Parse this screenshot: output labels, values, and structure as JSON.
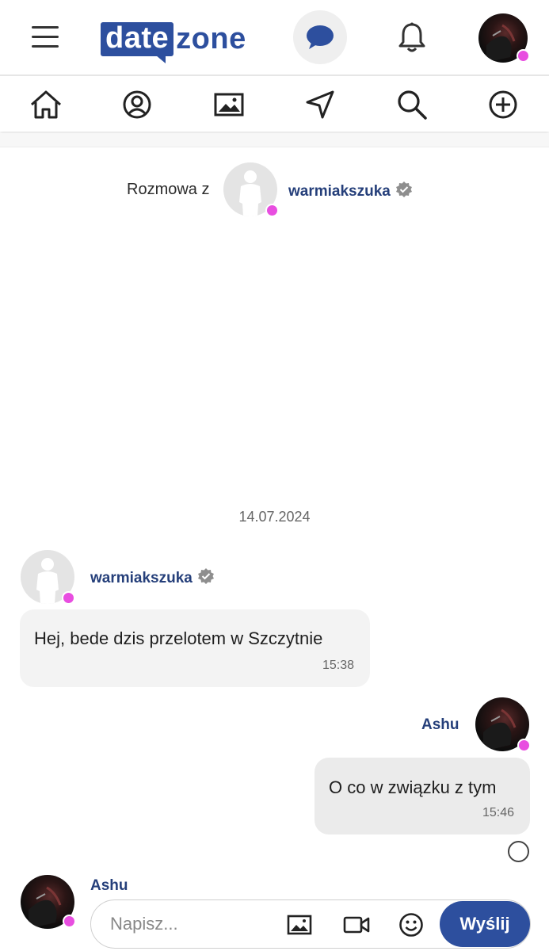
{
  "header": {
    "logo": {
      "part1": "date",
      "part2": "zone"
    },
    "icons": [
      "menu-icon",
      "chat-bubble-icon",
      "bell-icon"
    ],
    "accent_color": "#2d4f9e",
    "online_color": "#e84ee0"
  },
  "nav": {
    "items": [
      "home-icon",
      "user-circle-icon",
      "image-icon",
      "navigation-arrow-icon",
      "search-icon",
      "plus-circle-icon"
    ]
  },
  "conversation": {
    "label": "Rozmowa z",
    "partner": "warmiakszuka"
  },
  "messages": {
    "date": "14.07.2024",
    "incoming": {
      "sender": "warmiakszuka",
      "text": "Hej, bede dzis przelotem w Szczytnie",
      "time": "15:38"
    },
    "outgoing": {
      "sender": "Ashu",
      "text": "O co w związku z tym",
      "time": "15:46"
    }
  },
  "compose": {
    "sender": "Ashu",
    "placeholder": "Napisz...",
    "send_label": "Wyślij",
    "icons": [
      "image-icon",
      "video-camera-icon",
      "emoji-icon"
    ]
  }
}
